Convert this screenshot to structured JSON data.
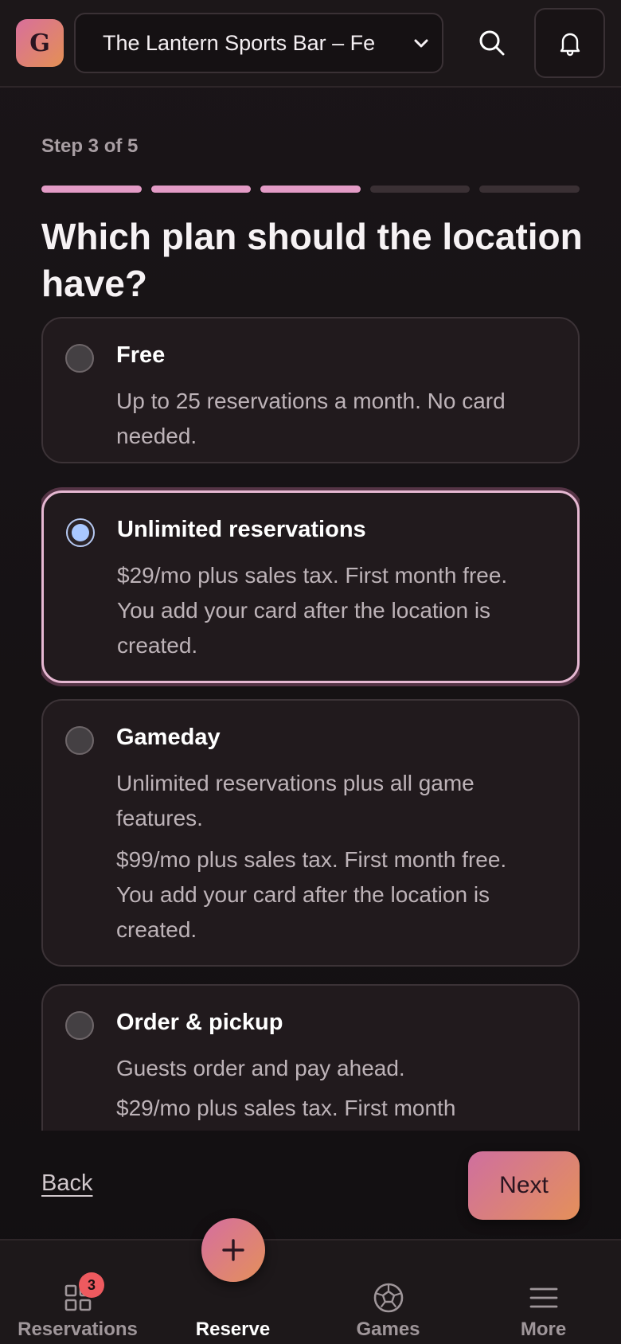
{
  "header": {
    "logo_letter": "G",
    "venue_selected": "The Lantern Sports Bar – Fe"
  },
  "wizard": {
    "step_label": "Step 3 of 5",
    "steps_total": 5,
    "steps_completed": 3,
    "question": "Which plan should the location have?"
  },
  "plans": [
    {
      "title": "Free",
      "desc": [
        "Up to 25 reservations a month. No card needed."
      ],
      "selected": false
    },
    {
      "title": "Unlimited reservations",
      "desc": [
        "$29/mo plus sales tax. First month free. You add your card after the location is created."
      ],
      "selected": true
    },
    {
      "title": "Gameday",
      "desc": [
        "Unlimited reservations plus all game features.",
        "$99/mo plus sales tax. First month free. You add your card after the location is created."
      ],
      "selected": false
    },
    {
      "title": "Order & pickup",
      "desc": [
        "Guests order and pay ahead.",
        "$29/mo plus sales tax. First month"
      ],
      "selected": false
    }
  ],
  "actions": {
    "back_label": "Back",
    "next_label": "Next"
  },
  "bottom_nav": {
    "reservations_label": "Reservations",
    "reservations_badge": "3",
    "reserve_label": "Reserve",
    "games_label": "Games",
    "more_label": "More"
  },
  "colors": {
    "accent_pink": "#e39bc6",
    "accent_orange": "#e4905a",
    "badge_red": "#ee5a5f",
    "radio_selected": "#a9c8ff"
  }
}
